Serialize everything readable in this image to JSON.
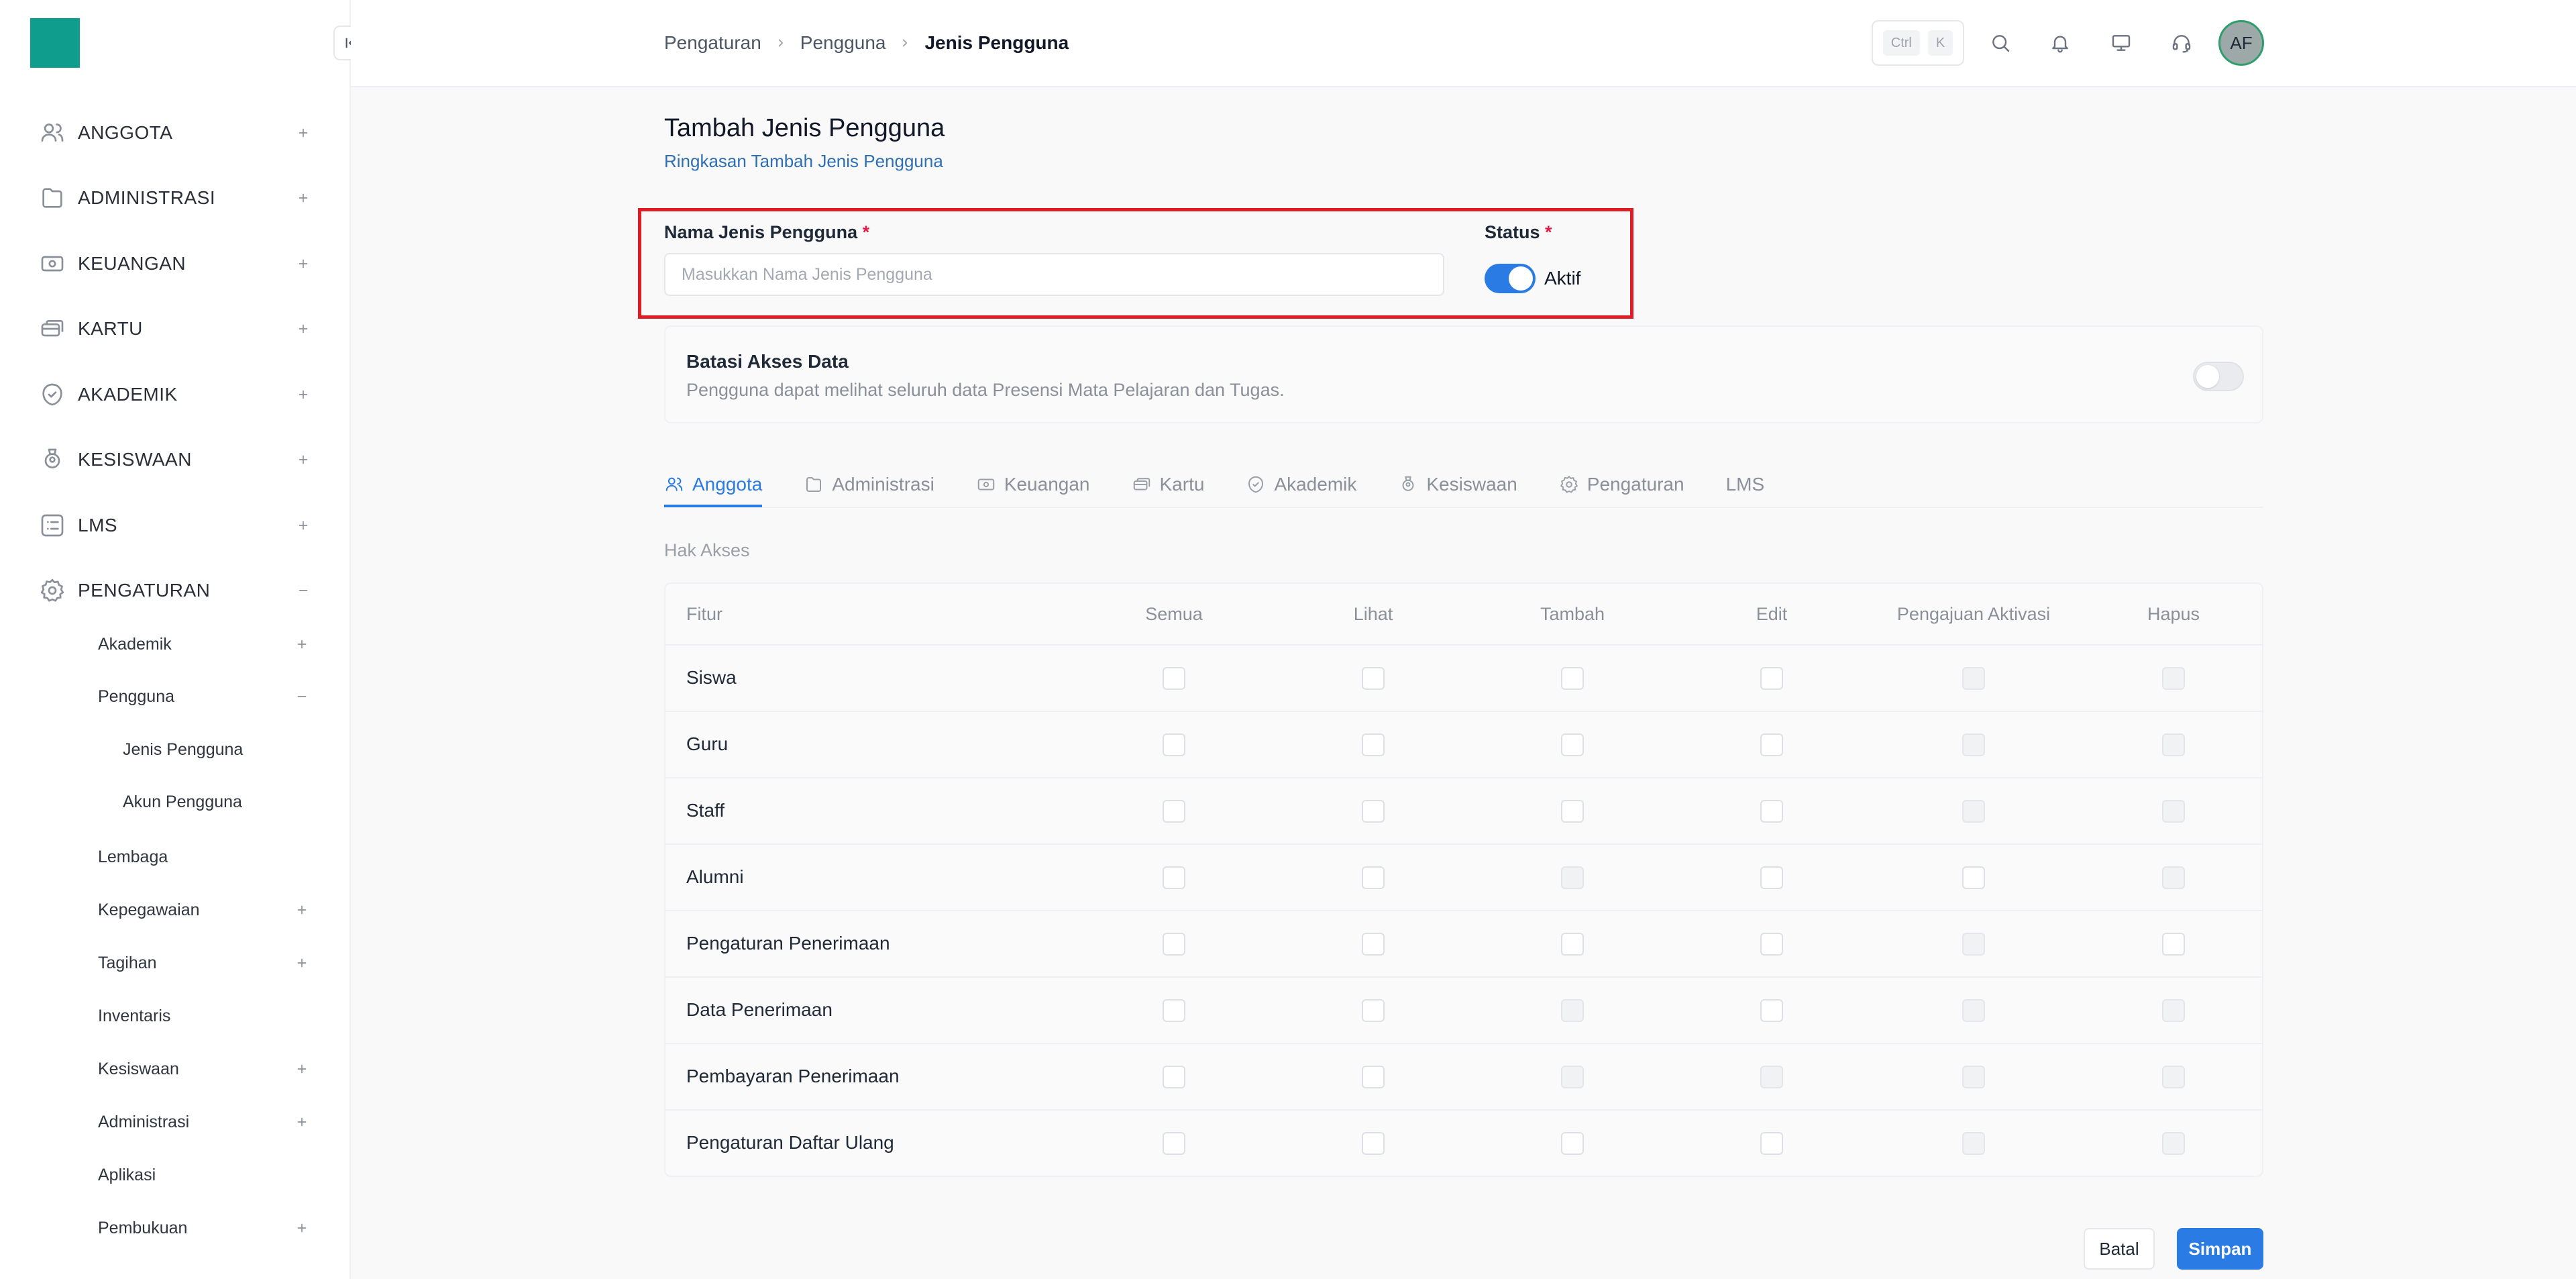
{
  "sidebar": {
    "items": [
      {
        "label": "ANGGOTA",
        "icon": "users-icon",
        "toggle": "plus"
      },
      {
        "label": "ADMINISTRASI",
        "icon": "folder-icon",
        "toggle": "plus"
      },
      {
        "label": "KEUANGAN",
        "icon": "money-icon",
        "toggle": "plus"
      },
      {
        "label": "KARTU",
        "icon": "cards-icon",
        "toggle": "plus"
      },
      {
        "label": "AKADEMIK",
        "icon": "academic-icon",
        "toggle": "plus"
      },
      {
        "label": "KESISWAAN",
        "icon": "student-badge-icon",
        "toggle": "plus"
      },
      {
        "label": "LMS",
        "icon": "list-icon",
        "toggle": "plus"
      },
      {
        "label": "PENGATURAN",
        "icon": "gear-icon",
        "toggle": "minus"
      }
    ],
    "pengaturan_sub": [
      {
        "label": "Akademik",
        "toggle": "plus"
      },
      {
        "label": "Pengguna",
        "toggle": "minus"
      },
      {
        "label": "Lembaga",
        "toggle": ""
      },
      {
        "label": "Kepegawaian",
        "toggle": "plus"
      },
      {
        "label": "Tagihan",
        "toggle": "plus"
      },
      {
        "label": "Inventaris",
        "toggle": ""
      },
      {
        "label": "Kesiswaan",
        "toggle": "plus"
      },
      {
        "label": "Administrasi",
        "toggle": "plus"
      },
      {
        "label": "Aplikasi",
        "toggle": ""
      },
      {
        "label": "Pembukuan",
        "toggle": "plus"
      }
    ],
    "pengguna_sub": [
      {
        "label": "Jenis Pengguna"
      },
      {
        "label": "Akun Pengguna"
      }
    ]
  },
  "breadcrumb": [
    "Pengaturan",
    "Pengguna",
    "Jenis Pengguna"
  ],
  "kbd": {
    "ctrl": "Ctrl",
    "k": "K"
  },
  "avatar": "AF",
  "page": {
    "title": "Tambah Jenis Pengguna",
    "subtitle": "Ringkasan Tambah Jenis Pengguna"
  },
  "form": {
    "name_label": "Nama Jenis Pengguna",
    "required_mark": "*",
    "name_placeholder": "Masukkan Nama Jenis Pengguna",
    "name_value": "",
    "status_label": "Status",
    "status_value": "Aktif",
    "status_on": true
  },
  "restrict": {
    "title": "Batasi Akses Data",
    "description": "Pengguna dapat melihat seluruh data Presensi Mata Pelajaran dan Tugas.",
    "enabled": false
  },
  "tabs": [
    {
      "label": "Anggota",
      "icon": "users-icon",
      "active": true
    },
    {
      "label": "Administrasi",
      "icon": "folder-icon",
      "active": false
    },
    {
      "label": "Keuangan",
      "icon": "money-icon",
      "active": false
    },
    {
      "label": "Kartu",
      "icon": "cards-icon",
      "active": false
    },
    {
      "label": "Akademik",
      "icon": "academic-icon",
      "active": false
    },
    {
      "label": "Kesiswaan",
      "icon": "student-badge-icon",
      "active": false
    },
    {
      "label": "Pengaturan",
      "icon": "gear-icon",
      "active": false
    },
    {
      "label": "LMS",
      "icon": "",
      "active": false
    }
  ],
  "permissions": {
    "section_label": "Hak Akses",
    "columns": [
      "Fitur",
      "Semua",
      "Lihat",
      "Tambah",
      "Edit",
      "Pengajuan Aktivasi",
      "Hapus"
    ],
    "rows": [
      {
        "feature": "Siswa",
        "enabled": [
          true,
          true,
          true,
          true,
          false,
          false
        ]
      },
      {
        "feature": "Guru",
        "enabled": [
          true,
          true,
          true,
          true,
          false,
          false
        ]
      },
      {
        "feature": "Staff",
        "enabled": [
          true,
          true,
          true,
          true,
          false,
          false
        ]
      },
      {
        "feature": "Alumni",
        "enabled": [
          true,
          true,
          false,
          true,
          true,
          false
        ]
      },
      {
        "feature": "Pengaturan Penerimaan",
        "enabled": [
          true,
          true,
          true,
          true,
          false,
          true
        ]
      },
      {
        "feature": "Data Penerimaan",
        "enabled": [
          true,
          true,
          false,
          true,
          false,
          false
        ]
      },
      {
        "feature": "Pembayaran Penerimaan",
        "enabled": [
          true,
          true,
          false,
          false,
          false,
          false
        ]
      },
      {
        "feature": "Pengaturan Daftar Ulang",
        "enabled": [
          true,
          true,
          true,
          true,
          false,
          false
        ]
      }
    ]
  },
  "actions": {
    "cancel": "Batal",
    "save": "Simpan"
  },
  "colors": {
    "accent": "#2b7be5",
    "brand": "#0f9d8e",
    "required": "#e11d48",
    "highlight": "#e01b24"
  }
}
